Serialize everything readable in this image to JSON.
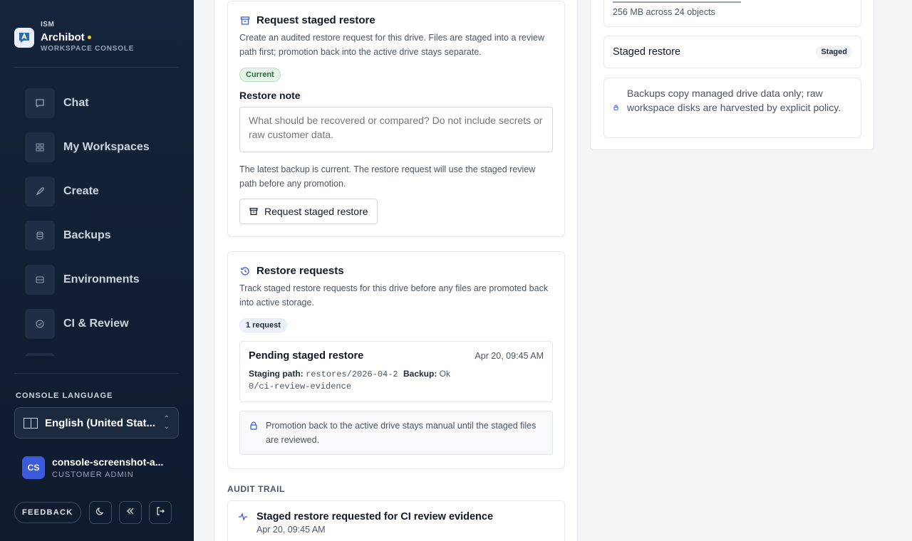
{
  "brand": {
    "org": "ISM",
    "name": "Archibot",
    "subtitle": "WORKSPACE CONSOLE"
  },
  "nav": {
    "items": [
      {
        "label": "Chat",
        "icon": "chat-icon"
      },
      {
        "label": "My Workspaces",
        "icon": "grid-icon"
      },
      {
        "label": "Create",
        "icon": "rocket-icon"
      },
      {
        "label": "Backups",
        "icon": "database-icon"
      },
      {
        "label": "Environments",
        "icon": "server-icon"
      },
      {
        "label": "CI & Review",
        "icon": "check-circle-icon"
      }
    ]
  },
  "language": {
    "heading": "CONSOLE LANGUAGE",
    "value": "English (United Stat..."
  },
  "user": {
    "initials": "CS",
    "name": "console-screenshot-a...",
    "role": "CUSTOMER ADMIN"
  },
  "footer": {
    "feedback": "FEEDBACK"
  },
  "restore_form": {
    "title": "Request staged restore",
    "description": "Create an audited restore request for this drive. Files are staged into a review path first; promotion back into the active drive stays separate.",
    "status": "Current",
    "note_label": "Restore note",
    "note_placeholder": "What should be recovered or compared? Do not include secrets or raw customer data.",
    "info": "The latest backup is current. The restore request will use the staged review path before any promotion.",
    "button": "Request staged restore"
  },
  "restore_requests": {
    "title": "Restore requests",
    "description": "Track staged restore requests for this drive before any files are promoted back into active storage.",
    "count": "1 request",
    "request": {
      "title": "Pending staged restore",
      "time": "Apr 20, 09:45 AM",
      "staging_label": "Staging path:",
      "staging_value_1": "restores/2026-04-2",
      "staging_value_2": "0/ci-review-evidence",
      "backup_label": "Backup:",
      "backup_value": "Ok"
    },
    "note": "Promotion back to the active drive stays manual until the staged files are reviewed."
  },
  "audit": {
    "heading": "AUDIT TRAIL",
    "entry": {
      "title": "Staged restore requested for CI review evidence",
      "time": "Apr 20, 09:45 AM"
    }
  },
  "right": {
    "backup_size": "256 MB across 24 objects",
    "staged_label": "Staged restore",
    "staged_badge": "Staged",
    "policy_note": "Backups copy managed drive data only; raw workspace disks are harvested by explicit policy."
  },
  "colors": {
    "sidebar": "#15243a",
    "accent": "#3b5bdb",
    "status_green": "#2f6b40",
    "brand_dot": "#facc15"
  }
}
